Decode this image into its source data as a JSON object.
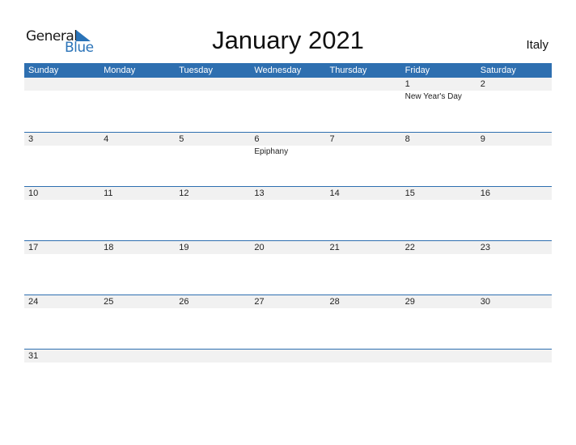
{
  "brand": {
    "word1": "General",
    "word2": "Blue",
    "accent": "#2a73b8"
  },
  "title": "January 2021",
  "country": "Italy",
  "weekdays": [
    "Sunday",
    "Monday",
    "Tuesday",
    "Wednesday",
    "Thursday",
    "Friday",
    "Saturday"
  ],
  "weeks": [
    [
      {
        "d": "",
        "h": ""
      },
      {
        "d": "",
        "h": ""
      },
      {
        "d": "",
        "h": ""
      },
      {
        "d": "",
        "h": ""
      },
      {
        "d": "",
        "h": ""
      },
      {
        "d": "1",
        "h": "New Year's Day"
      },
      {
        "d": "2",
        "h": ""
      }
    ],
    [
      {
        "d": "3",
        "h": ""
      },
      {
        "d": "4",
        "h": ""
      },
      {
        "d": "5",
        "h": ""
      },
      {
        "d": "6",
        "h": "Epiphany"
      },
      {
        "d": "7",
        "h": ""
      },
      {
        "d": "8",
        "h": ""
      },
      {
        "d": "9",
        "h": ""
      }
    ],
    [
      {
        "d": "10",
        "h": ""
      },
      {
        "d": "11",
        "h": ""
      },
      {
        "d": "12",
        "h": ""
      },
      {
        "d": "13",
        "h": ""
      },
      {
        "d": "14",
        "h": ""
      },
      {
        "d": "15",
        "h": ""
      },
      {
        "d": "16",
        "h": ""
      }
    ],
    [
      {
        "d": "17",
        "h": ""
      },
      {
        "d": "18",
        "h": ""
      },
      {
        "d": "19",
        "h": ""
      },
      {
        "d": "20",
        "h": ""
      },
      {
        "d": "21",
        "h": ""
      },
      {
        "d": "22",
        "h": ""
      },
      {
        "d": "23",
        "h": ""
      }
    ],
    [
      {
        "d": "24",
        "h": ""
      },
      {
        "d": "25",
        "h": ""
      },
      {
        "d": "26",
        "h": ""
      },
      {
        "d": "27",
        "h": ""
      },
      {
        "d": "28",
        "h": ""
      },
      {
        "d": "29",
        "h": ""
      },
      {
        "d": "30",
        "h": ""
      }
    ],
    [
      {
        "d": "31",
        "h": ""
      },
      {
        "d": "",
        "h": ""
      },
      {
        "d": "",
        "h": ""
      },
      {
        "d": "",
        "h": ""
      },
      {
        "d": "",
        "h": ""
      },
      {
        "d": "",
        "h": ""
      },
      {
        "d": "",
        "h": ""
      }
    ]
  ]
}
